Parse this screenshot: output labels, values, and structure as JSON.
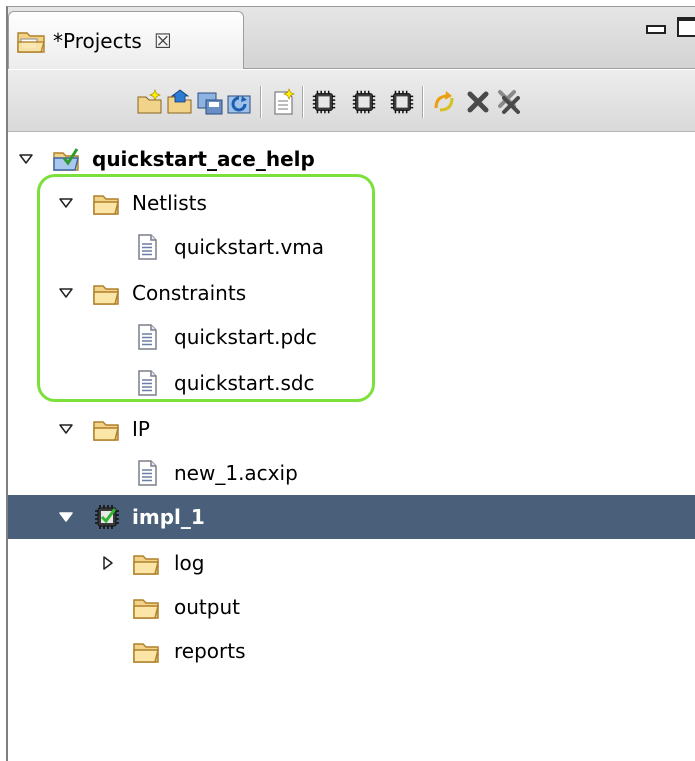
{
  "tab": {
    "title": "*Projects",
    "close_icon": "close-icon",
    "icon": "projects-folder-icon"
  },
  "toolbar": {
    "buttons": [
      "new-folder-icon",
      "open-project-icon",
      "save-project-icon",
      "refresh-project-icon",
      "new-file-icon",
      "add-chip-icon",
      "import-chip-icon",
      "save-chip-icon",
      "sync-icon",
      "delete-icon",
      "delete-all-icon"
    ]
  },
  "tree": {
    "project": {
      "label": "quickstart_ace_help",
      "icon": "project-icon"
    },
    "netlists": {
      "label": "Netlists",
      "files": [
        "quickstart.vma"
      ]
    },
    "constraints": {
      "label": "Constraints",
      "files": [
        "quickstart.pdc",
        "quickstart.sdc"
      ]
    },
    "ip": {
      "label": "IP",
      "files": [
        "new_1.acxip"
      ]
    },
    "impl": {
      "label": "impl_1",
      "icon": "implementation-chip-icon"
    },
    "impl_children": [
      {
        "label": "log",
        "expandable": true
      },
      {
        "label": "output",
        "expandable": false
      },
      {
        "label": "reports",
        "expandable": false
      }
    ]
  },
  "colors": {
    "selection": "#4a5f7a",
    "highlight_border": "#7be03a",
    "folder": "#f4c96a"
  }
}
